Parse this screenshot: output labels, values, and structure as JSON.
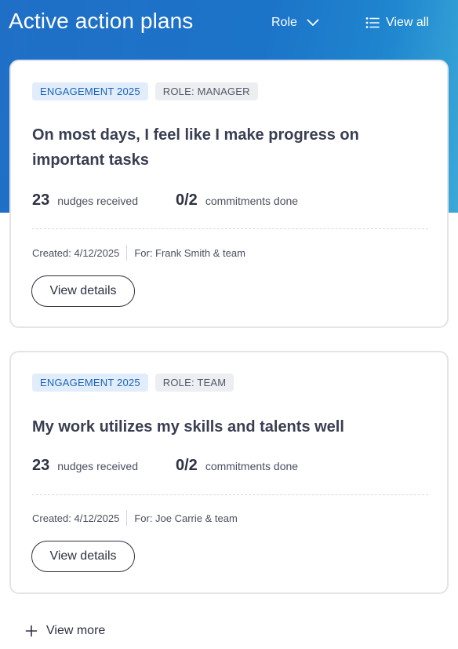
{
  "header": {
    "title": "Active action plans",
    "role_label": "Role",
    "view_all_label": "View all"
  },
  "plans": [
    {
      "tags": [
        "ENGAGEMENT 2025",
        "ROLE: MANAGER"
      ],
      "title": "On most days, I feel like I make progress on important tasks",
      "nudges_count": "23",
      "nudges_label": "nudges received",
      "commitments_count": "0/2",
      "commitments_label": "commitments done",
      "created": "Created: 4/12/2025",
      "for": "For: Frank Smith & team",
      "details_label": "View details"
    },
    {
      "tags": [
        "ENGAGEMENT 2025",
        "ROLE: TEAM"
      ],
      "title": "My work utilizes my skills and talents well",
      "nudges_count": "23",
      "nudges_label": "nudges received",
      "commitments_count": "0/2",
      "commitments_label": "commitments done",
      "created": "Created: 4/12/2025",
      "for": "For: Joe Carrie & team",
      "details_label": "View details"
    }
  ],
  "footer": {
    "view_more_label": "View more"
  },
  "icons": {
    "role": "chevron-down-icon",
    "view_all": "list-icon",
    "view_more": "plus-icon"
  },
  "colors": {
    "header_gradient_start": "#1f6fc6",
    "header_gradient_end": "#3aa9d8",
    "tag_blue_bg": "#e1edfb",
    "tag_blue_text": "#1b64b8",
    "tag_gray_bg": "#eceef1",
    "tag_gray_text": "#525866",
    "text_primary": "#2d3142"
  }
}
